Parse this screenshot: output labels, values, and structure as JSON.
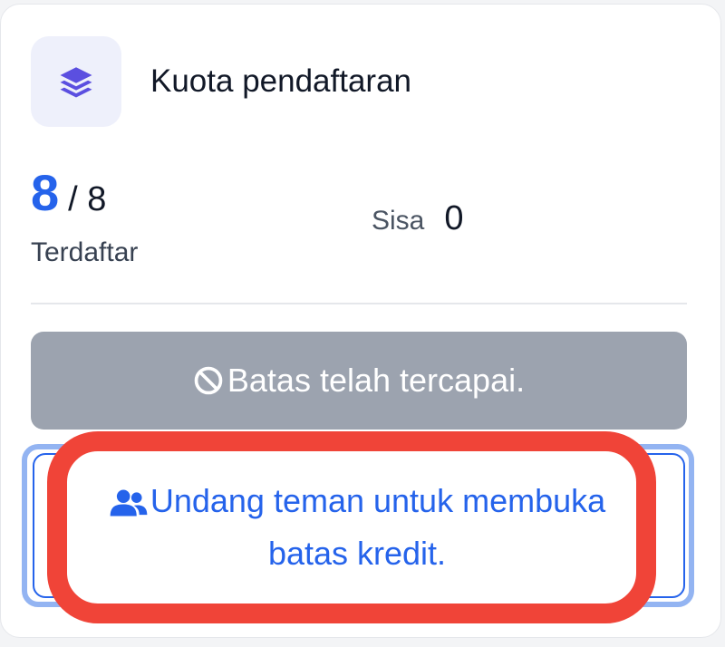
{
  "card": {
    "title": "Kuota pendaftaran",
    "icon": "layers-icon"
  },
  "stats": {
    "registered": "8",
    "total": "/ 8",
    "registered_label": "Terdaftar",
    "remaining_label": "Sisa",
    "remaining_value": "0"
  },
  "limit_button": {
    "label": "Batas telah tercapai.",
    "icon": "ban-icon"
  },
  "invite_button": {
    "label": "Undang teman untuk membuka batas kredit.",
    "icon": "users-icon"
  },
  "colors": {
    "accent": "#2563eb",
    "disabled": "#9ca3af",
    "highlight": "#f04438",
    "icon_purple": "#5b4fe0"
  }
}
